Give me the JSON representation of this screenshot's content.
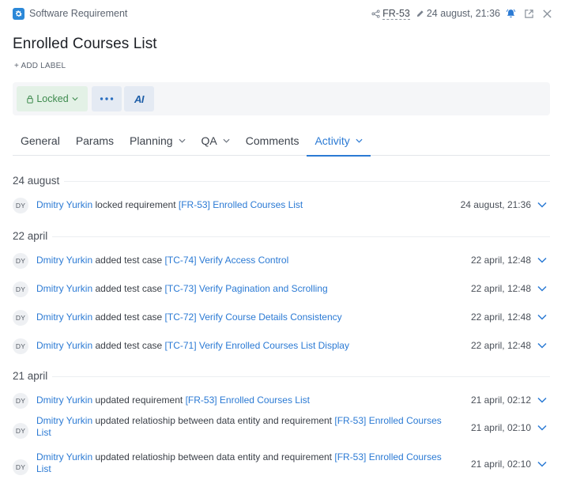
{
  "header": {
    "type_label": "Software Requirement",
    "req_id": "FR-53",
    "edit_date": "24 august, 21:36"
  },
  "title": "Enrolled Courses List",
  "add_label": "+ ADD LABEL",
  "toolbar": {
    "status_label": "Locked",
    "more_label": "•••",
    "ai_label": "AI"
  },
  "tabs": [
    {
      "label": "General",
      "dropdown": false
    },
    {
      "label": "Params",
      "dropdown": false
    },
    {
      "label": "Planning",
      "dropdown": true
    },
    {
      "label": "QA",
      "dropdown": true
    },
    {
      "label": "Comments",
      "dropdown": false
    },
    {
      "label": "Activity",
      "dropdown": true,
      "active": true
    }
  ],
  "colors": {
    "accent": "#2b7ad4",
    "locked_bg": "#e3f1e6",
    "locked_text": "#3d8a4d",
    "bell": "#2b7ad4"
  },
  "activity": [
    {
      "date": "24 august",
      "entries": [
        {
          "initials": "DY",
          "user": "Dmitry Yurkin",
          "action": " locked requirement ",
          "target": "[FR-53] Enrolled Courses List",
          "time": "24 august, 21:36"
        }
      ]
    },
    {
      "date": "22 april",
      "entries": [
        {
          "initials": "DY",
          "user": "Dmitry Yurkin",
          "action": " added test case ",
          "target": "[TC-74] Verify Access Control",
          "time": "22 april, 12:48"
        },
        {
          "initials": "DY",
          "user": "Dmitry Yurkin",
          "action": " added test case ",
          "target": "[TC-73] Verify Pagination and Scrolling",
          "time": "22 april, 12:48"
        },
        {
          "initials": "DY",
          "user": "Dmitry Yurkin",
          "action": " added test case ",
          "target": "[TC-72] Verify Course Details Consistency",
          "time": "22 april, 12:48"
        },
        {
          "initials": "DY",
          "user": "Dmitry Yurkin",
          "action": " added test case ",
          "target": "[TC-71] Verify Enrolled Courses List Display",
          "time": "22 april, 12:48"
        }
      ]
    },
    {
      "date": "21 april",
      "entries": [
        {
          "initials": "DY",
          "user": "Dmitry Yurkin",
          "action": " updated requirement ",
          "target": "[FR-53] Enrolled Courses List",
          "time": "21 april, 02:12"
        },
        {
          "initials": "DY",
          "user": "Dmitry Yurkin",
          "action": " updated relatioship between data entity and requirement ",
          "target": "[FR-53] Enrolled Courses List",
          "time": "21 april, 02:10"
        },
        {
          "initials": "DY",
          "user": "Dmitry Yurkin",
          "action": " updated relatioship between data entity and requirement ",
          "target": "[FR-53] Enrolled Courses List",
          "time": "21 april, 02:10"
        }
      ]
    }
  ]
}
